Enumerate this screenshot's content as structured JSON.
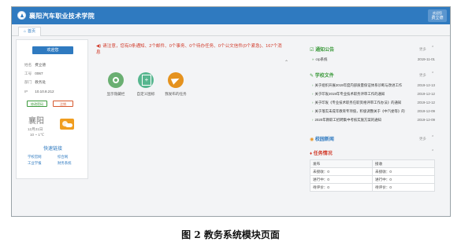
{
  "app": {
    "title": "襄阳汽车职业技术学院",
    "user_label": "欢迎您",
    "user_name": "费立德"
  },
  "tabs": [
    {
      "label": "首页"
    }
  ],
  "user_card": {
    "welcome": "欢迎您",
    "fields": [
      {
        "key": "姓名",
        "value": "费立德"
      },
      {
        "key": "工号",
        "value": "0067"
      },
      {
        "key": "部门",
        "value": "教务处"
      },
      {
        "key": "IP",
        "value": "10.10.8.212"
      }
    ],
    "change_pw_label": "修改密码",
    "logout_label": "注销",
    "weather": {
      "city": "襄阳",
      "date": "12月21日",
      "temp": "10 ~ 1℃"
    },
    "quick_title": "快速链接",
    "quick_links": [
      "学校官网",
      "综合网",
      "工业学报",
      "财务系统"
    ]
  },
  "notice": {
    "text": "请注意，您有0条通知、2个邮件、0个事务、0个待办任务、0个公文信件(0个紧急)、167个消息"
  },
  "actions": [
    {
      "label": "显示隐藏栏"
    },
    {
      "label": "自定义图标"
    },
    {
      "label": "我发布的任务"
    }
  ],
  "announcements": {
    "title": "通知公告",
    "more": "更多",
    "items": [
      {
        "title": "crp系统",
        "date": "2019-11-01"
      }
    ]
  },
  "documents": {
    "title": "学校文件",
    "more": "更多",
    "items": [
      {
        "title": "关于组织开展2019年度内部质量保证体系诊断与改进工作",
        "date": "2019-12-13"
      },
      {
        "title": "关于印发2019年专业技术职务评审工作的通知",
        "date": "2019-12-12"
      },
      {
        "title": "关于印发《专业技术职务任职资格评审工作办法》的通知",
        "date": "2019-12-12"
      },
      {
        "title": "关于落实未成年教育专项值，积极调整关于《中汽委等》的",
        "date": "2019-12-09"
      },
      {
        "title": "2020年教职工招聘集中考核实施方案的通知",
        "date": "2019-12-09"
      }
    ]
  },
  "campus_news": {
    "title": "校园新闻",
    "more": "更多"
  },
  "task_status": {
    "title": "任务情况",
    "headers": [
      "发布",
      "接收"
    ],
    "rows": [
      [
        "未接收：0",
        "未接收：0"
      ],
      [
        "进行中：0",
        "进行中：0"
      ],
      [
        "待评价：0",
        "待评价：0"
      ]
    ]
  },
  "caption": "图 2  教务系统模块页面"
}
